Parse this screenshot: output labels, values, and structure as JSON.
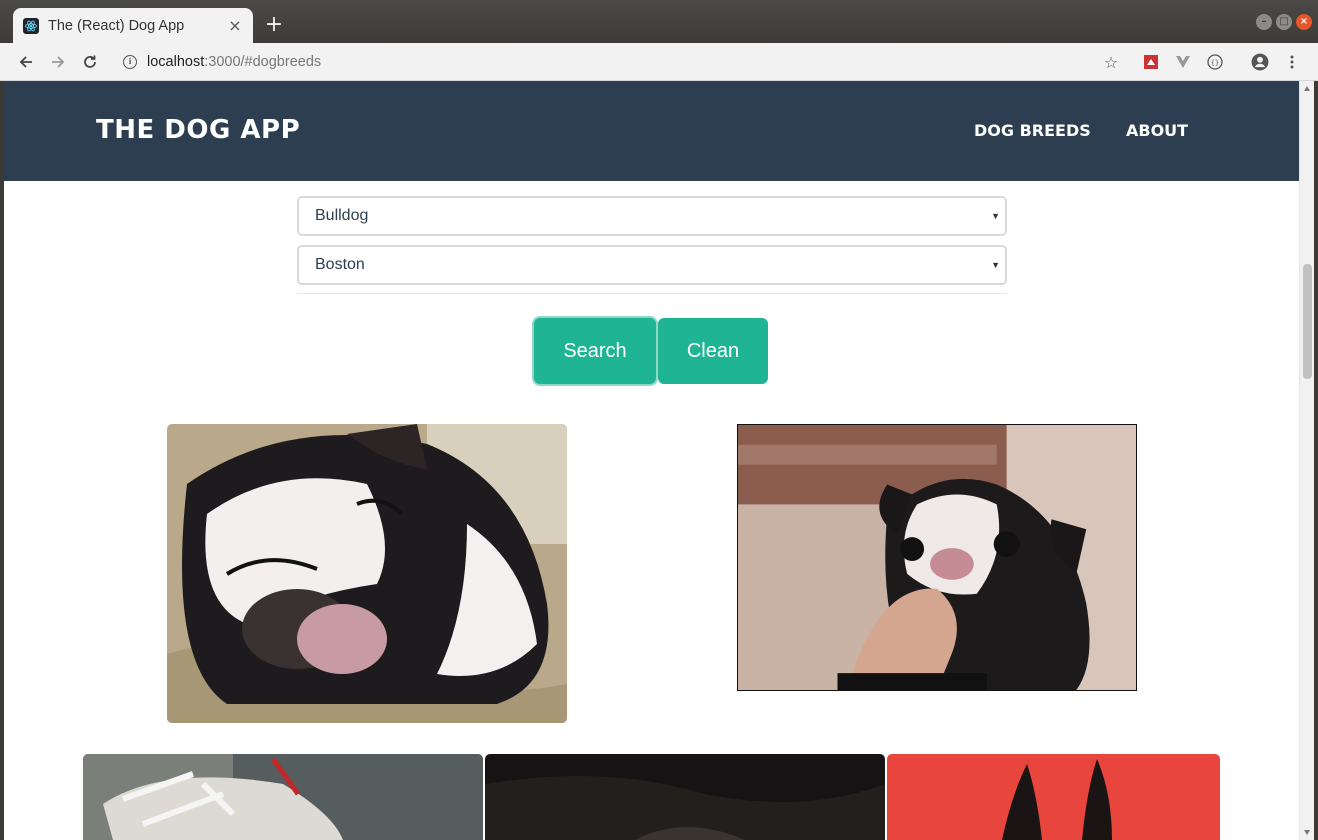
{
  "browser": {
    "tab_title": "The (React) Dog App",
    "tab_close": "×",
    "new_tab": "+",
    "url_host": "localhost",
    "url_rest": ":3000/#dogbreeds"
  },
  "navbar": {
    "brand": "THE DOG APP",
    "links": [
      "DOG BREEDS",
      "ABOUT"
    ]
  },
  "filters": {
    "breed_value": "Bulldog",
    "city_value": "Boston"
  },
  "buttons": {
    "search": "Search",
    "clean": "Clean"
  },
  "colors": {
    "navbar": "#2c3e50",
    "accent": "#1fb594"
  },
  "gallery": [
    {
      "description": "sleeping black and white dog"
    },
    {
      "description": "black and white puppy being petted"
    },
    {
      "description": "dog with rope toy (partially visible)"
    },
    {
      "description": "dog on dark background (partially visible)"
    },
    {
      "description": "dog ears on red background (partially visible)"
    }
  ]
}
